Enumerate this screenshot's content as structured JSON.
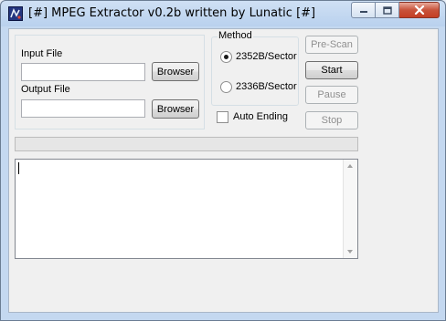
{
  "window": {
    "title": "[#] MPEG Extractor v0.2b written by Lunatic [#]"
  },
  "input_file": {
    "label": "Input File",
    "value": "",
    "browse_label": "Browser"
  },
  "output_file": {
    "label": "Output File",
    "value": "",
    "browse_label": "Browser"
  },
  "method": {
    "title": "Method",
    "options": [
      {
        "label": "2352B/Sector",
        "selected": true
      },
      {
        "label": "2336B/Sector",
        "selected": false
      }
    ]
  },
  "auto_ending": {
    "label": "Auto Ending",
    "checked": false
  },
  "actions": {
    "prescan_label": "Pre-Scan",
    "start_label": "Start",
    "pause_label": "Pause",
    "stop_label": "Stop"
  },
  "progress": {
    "value": 0
  },
  "log": {
    "text": ""
  },
  "icons": {
    "app": "mpeg-extractor-app-icon",
    "minimize": "minimize-icon",
    "maximize": "maximize-icon",
    "close": "close-icon",
    "scroll_up": "scroll-up-arrow-icon",
    "scroll_down": "scroll-down-arrow-icon"
  },
  "colors": {
    "titlebar": "#b9d1ee",
    "close_button": "#c8523a",
    "client_background": "#f0f0f0"
  }
}
